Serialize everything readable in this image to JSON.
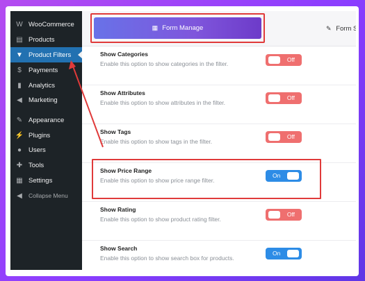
{
  "sidebar": {
    "items": [
      {
        "label": "WooCommerce",
        "icon": "woocommerce-icon"
      },
      {
        "label": "Products",
        "icon": "products-icon"
      },
      {
        "label": "Product Filters",
        "icon": "filter-icon"
      },
      {
        "label": "Payments",
        "icon": "payments-icon"
      },
      {
        "label": "Analytics",
        "icon": "analytics-icon"
      },
      {
        "label": "Marketing",
        "icon": "megaphone-icon"
      },
      {
        "label": "Appearance",
        "icon": "paintbrush-icon"
      },
      {
        "label": "Plugins",
        "icon": "plugin-icon"
      },
      {
        "label": "Users",
        "icon": "users-icon"
      },
      {
        "label": "Tools",
        "icon": "wrench-icon"
      },
      {
        "label": "Settings",
        "icon": "settings-icon"
      }
    ],
    "collapse_label": "Collapse Menu",
    "active_index": 2
  },
  "tabs": {
    "active_label": "Form Manage",
    "second_label": "Form S"
  },
  "settings": [
    {
      "title": "Show Categories",
      "desc": "Enable this option to show categories in the filter.",
      "state": "Off"
    },
    {
      "title": "Show Attributes",
      "desc": "Enable this option to show attributes in the filter.",
      "state": "Off"
    },
    {
      "title": "Show Tags",
      "desc": "Enable this option to show tags in the filter.",
      "state": "Off"
    },
    {
      "title": "Show Price Range",
      "desc": "Enable this option to show price range filter.",
      "state": "On"
    },
    {
      "title": "Show Rating",
      "desc": "Enable this option to show product rating filter.",
      "state": "Off"
    },
    {
      "title": "Show Search",
      "desc": "Enable this option to show search box for products.",
      "state": "On"
    }
  ],
  "colors": {
    "sidebar_bg": "#1d2327",
    "active_menu": "#2271b1",
    "toggle_on": "#2d8ce6",
    "toggle_off": "#ef6f6f",
    "highlight": "#e03a3a"
  }
}
